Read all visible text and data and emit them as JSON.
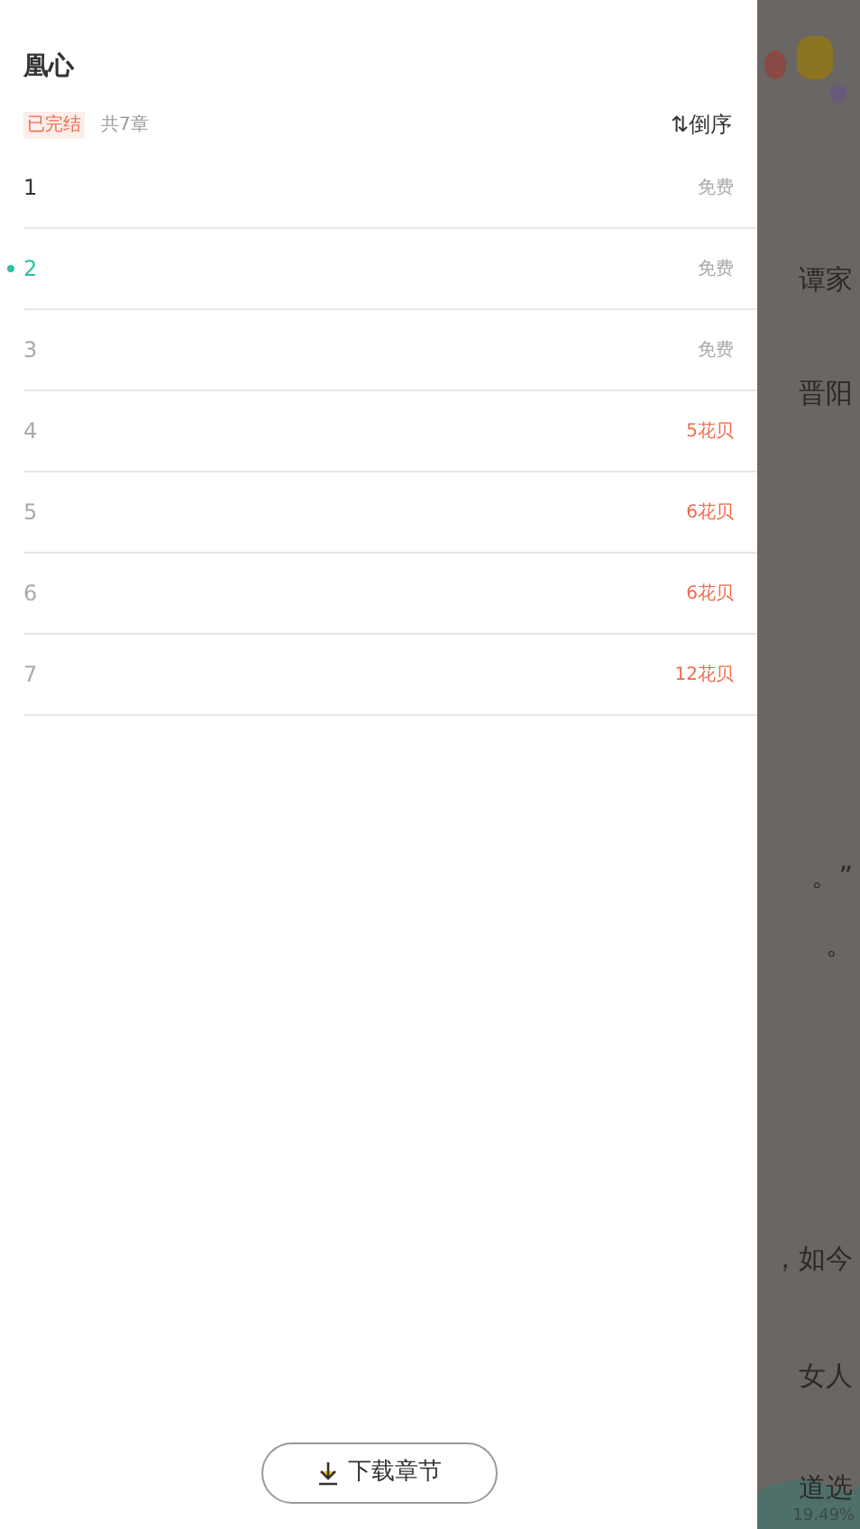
{
  "drawer": {
    "title": "凰心",
    "status_badge": "已完结",
    "chapter_count": "共7章",
    "sort_button": {
      "icon": "⇅",
      "label": "倒序"
    },
    "chapters": [
      {
        "number": "1",
        "price": "免费",
        "kind": "free",
        "selected": false,
        "dimmed": false
      },
      {
        "number": "2",
        "price": "免费",
        "kind": "free",
        "selected": true,
        "dimmed": false
      },
      {
        "number": "3",
        "price": "免费",
        "kind": "free",
        "selected": false,
        "dimmed": true
      },
      {
        "number": "4",
        "price": "5花贝",
        "kind": "paid",
        "selected": false,
        "dimmed": true
      },
      {
        "number": "5",
        "price": "6花贝",
        "kind": "paid",
        "selected": false,
        "dimmed": true
      },
      {
        "number": "6",
        "price": "6花贝",
        "kind": "paid",
        "selected": false,
        "dimmed": true
      },
      {
        "number": "7",
        "price": "12花贝",
        "kind": "paid",
        "selected": false,
        "dimmed": true
      }
    ],
    "download_button": "下载章节"
  },
  "reader_page": {
    "lines": [
      "谭家",
      "晋阳",
      "。”",
      "。",
      "，如今",
      "女人",
      "道选"
    ],
    "progress": "19.49%"
  }
}
